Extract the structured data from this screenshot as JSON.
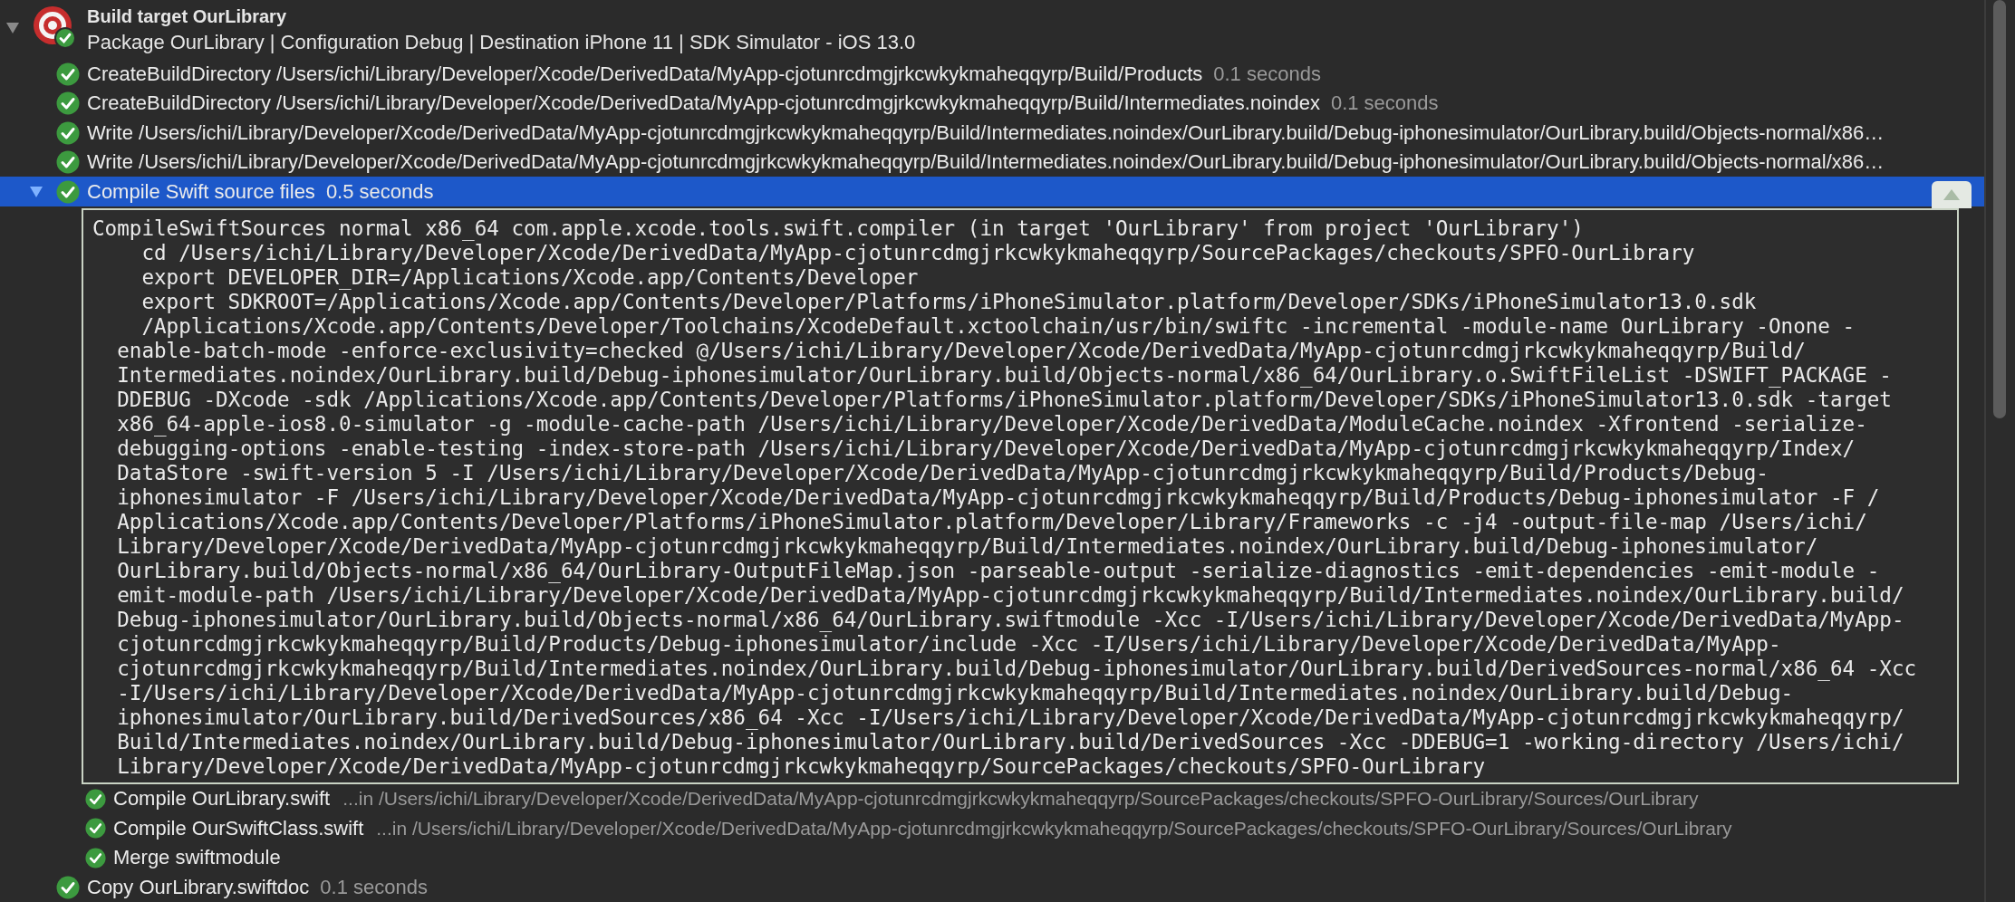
{
  "build_target": {
    "title": "Build target OurLibrary",
    "subtitle": "Package OurLibrary | Configuration Debug | Destination iPhone 11 | SDK Simulator - iOS 13.0",
    "expanded": true
  },
  "steps": [
    {
      "label": "CreateBuildDirectory /Users/ichi/Library/Developer/Xcode/DerivedData/MyApp-cjotunrcdmgjrkcwkykmaheqqyrp/Build/Products",
      "duration": "0.1 seconds",
      "selected": false
    },
    {
      "label": "CreateBuildDirectory /Users/ichi/Library/Developer/Xcode/DerivedData/MyApp-cjotunrcdmgjrkcwkykmaheqqyrp/Build/Intermediates.noindex",
      "duration": "0.1 seconds",
      "selected": false
    },
    {
      "label": "Write /Users/ichi/Library/Developer/Xcode/DerivedData/MyApp-cjotunrcdmgjrkcwkykmaheqqyrp/Build/Intermediates.noindex/OurLibrary.build/Debug-iphonesimulator/OurLibrary.build/Objects-normal/x86…",
      "selected": false
    },
    {
      "label": "Write /Users/ichi/Library/Developer/Xcode/DerivedData/MyApp-cjotunrcdmgjrkcwkykmaheqqyrp/Build/Intermediates.noindex/OurLibrary.build/Debug-iphonesimulator/OurLibrary.build/Objects-normal/x86…",
      "selected": false
    },
    {
      "label": "Compile Swift source files",
      "duration": "0.5 seconds",
      "selected": true,
      "expanded": true,
      "log": [
        {
          "kind": "command",
          "text": "CompileSwiftSources normal x86_64 com.apple.xcode.tools.swift.compiler (in target 'OurLibrary' from project 'OurLibrary')"
        },
        {
          "kind": "step",
          "text": "cd /Users/ichi/Library/Developer/Xcode/DerivedData/MyApp-cjotunrcdmgjrkcwkykmaheqqyrp/SourcePackages/checkouts/SPFO-OurLibrary"
        },
        {
          "kind": "step",
          "text": "export DEVELOPER_DIR=/Applications/Xcode.app/Contents/Developer"
        },
        {
          "kind": "step",
          "text": "export SDKROOT=/Applications/Xcode.app/Contents/Developer/Platforms/iPhoneSimulator.platform/Developer/SDKs/iPhoneSimulator13.0.sdk"
        },
        {
          "kind": "step",
          "text": "/Applications/Xcode.app/Contents/Developer/Toolchains/XcodeDefault.xctoolchain/usr/bin/swiftc -incremental -module-name OurLibrary -Onone -"
        },
        {
          "kind": "wrap",
          "text": "enable-batch-mode -enforce-exclusivity=checked @/Users/ichi/Library/Developer/Xcode/DerivedData/MyApp-cjotunrcdmgjrkcwkykmaheqqyrp/Build/"
        },
        {
          "kind": "wrap",
          "text": "Intermediates.noindex/OurLibrary.build/Debug-iphonesimulator/OurLibrary.build/Objects-normal/x86_64/OurLibrary.o.SwiftFileList -DSWIFT_PACKAGE -"
        },
        {
          "kind": "wrap",
          "text": "DDEBUG -DXcode -sdk /Applications/Xcode.app/Contents/Developer/Platforms/iPhoneSimulator.platform/Developer/SDKs/iPhoneSimulator13.0.sdk -target"
        },
        {
          "kind": "wrap",
          "text": "x86_64-apple-ios8.0-simulator -g -module-cache-path /Users/ichi/Library/Developer/Xcode/DerivedData/ModuleCache.noindex -Xfrontend -serialize-"
        },
        {
          "kind": "wrap",
          "text": "debugging-options -enable-testing -index-store-path /Users/ichi/Library/Developer/Xcode/DerivedData/MyApp-cjotunrcdmgjrkcwkykmaheqqyrp/Index/"
        },
        {
          "kind": "wrap",
          "text": "DataStore -swift-version 5 -I /Users/ichi/Library/Developer/Xcode/DerivedData/MyApp-cjotunrcdmgjrkcwkykmaheqqyrp/Build/Products/Debug-"
        },
        {
          "kind": "wrap",
          "text": "iphonesimulator -F /Users/ichi/Library/Developer/Xcode/DerivedData/MyApp-cjotunrcdmgjrkcwkykmaheqqyrp/Build/Products/Debug-iphonesimulator -F /"
        },
        {
          "kind": "wrap",
          "text": "Applications/Xcode.app/Contents/Developer/Platforms/iPhoneSimulator.platform/Developer/Library/Frameworks -c -j4 -output-file-map /Users/ichi/"
        },
        {
          "kind": "wrap",
          "text": "Library/Developer/Xcode/DerivedData/MyApp-cjotunrcdmgjrkcwkykmaheqqyrp/Build/Intermediates.noindex/OurLibrary.build/Debug-iphonesimulator/"
        },
        {
          "kind": "wrap",
          "text": "OurLibrary.build/Objects-normal/x86_64/OurLibrary-OutputFileMap.json -parseable-output -serialize-diagnostics -emit-dependencies -emit-module -"
        },
        {
          "kind": "wrap",
          "text": "emit-module-path /Users/ichi/Library/Developer/Xcode/DerivedData/MyApp-cjotunrcdmgjrkcwkykmaheqqyrp/Build/Intermediates.noindex/OurLibrary.build/"
        },
        {
          "kind": "wrap",
          "text": "Debug-iphonesimulator/OurLibrary.build/Objects-normal/x86_64/OurLibrary.swiftmodule -Xcc -I/Users/ichi/Library/Developer/Xcode/DerivedData/MyApp-"
        },
        {
          "kind": "wrap",
          "text": "cjotunrcdmgjrkcwkykmaheqqyrp/Build/Products/Debug-iphonesimulator/include -Xcc -I/Users/ichi/Library/Developer/Xcode/DerivedData/MyApp-"
        },
        {
          "kind": "wrap",
          "text": "cjotunrcdmgjrkcwkykmaheqqyrp/Build/Intermediates.noindex/OurLibrary.build/Debug-iphonesimulator/OurLibrary.build/DerivedSources-normal/x86_64 -Xcc"
        },
        {
          "kind": "wrap",
          "text": "-I/Users/ichi/Library/Developer/Xcode/DerivedData/MyApp-cjotunrcdmgjrkcwkykmaheqqyrp/Build/Intermediates.noindex/OurLibrary.build/Debug-"
        },
        {
          "kind": "wrap",
          "text": "iphonesimulator/OurLibrary.build/DerivedSources/x86_64 -Xcc -I/Users/ichi/Library/Developer/Xcode/DerivedData/MyApp-cjotunrcdmgjrkcwkykmaheqqyrp/"
        },
        {
          "kind": "wrap",
          "text": "Build/Intermediates.noindex/OurLibrary.build/Debug-iphonesimulator/OurLibrary.build/DerivedSources -Xcc -DDEBUG=1 -working-directory /Users/ichi/"
        },
        {
          "kind": "wrap",
          "text": "Library/Developer/Xcode/DerivedData/MyApp-cjotunrcdmgjrkcwkykmaheqqyrp/SourcePackages/checkouts/SPFO-OurLibrary"
        }
      ],
      "children": [
        {
          "label": "Compile OurLibrary.swift",
          "location": "...in /Users/ichi/Library/Developer/Xcode/DerivedData/MyApp-cjotunrcdmgjrkcwkykmaheqqyrp/SourcePackages/checkouts/SPFO-OurLibrary/Sources/OurLibrary"
        },
        {
          "label": "Compile OurSwiftClass.swift",
          "location": "...in /Users/ichi/Library/Developer/Xcode/DerivedData/MyApp-cjotunrcdmgjrkcwkykmaheqqyrp/SourcePackages/checkouts/SPFO-OurLibrary/Sources/OurLibrary"
        },
        {
          "label": "Merge swiftmodule"
        }
      ]
    },
    {
      "label": "Copy OurLibrary.swiftdoc",
      "duration": "0.1 seconds",
      "selected": false
    }
  ]
}
